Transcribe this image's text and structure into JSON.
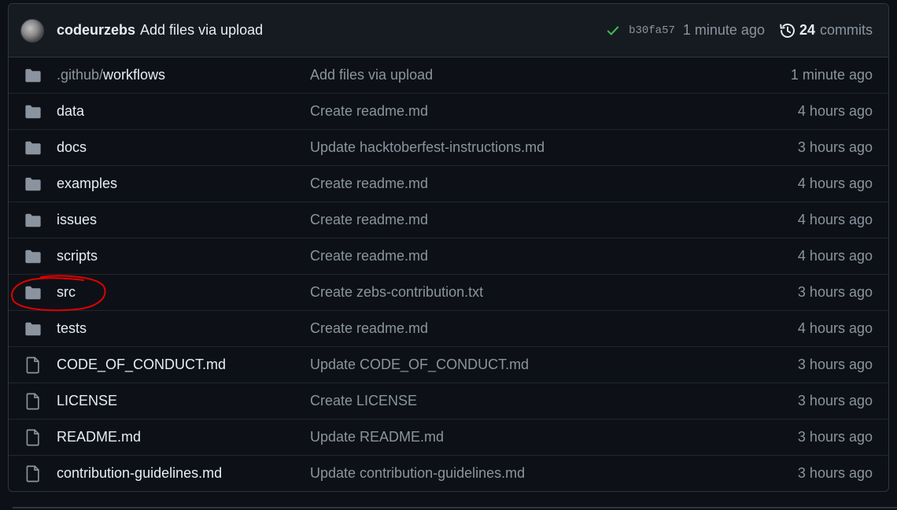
{
  "commit": {
    "author": "codeurzebs",
    "message": "Add files via upload",
    "sha": "b30fa57",
    "time": "1 minute ago",
    "count": "24",
    "count_label": "commits"
  },
  "files": [
    {
      "type": "folder",
      "prefix": ".github/",
      "name": "workflows",
      "message": "Add files via upload",
      "age": "1 minute ago"
    },
    {
      "type": "folder",
      "prefix": "",
      "name": "data",
      "message": "Create readme.md",
      "age": "4 hours ago"
    },
    {
      "type": "folder",
      "prefix": "",
      "name": "docs",
      "message": "Update hacktoberfest-instructions.md",
      "age": "3 hours ago"
    },
    {
      "type": "folder",
      "prefix": "",
      "name": "examples",
      "message": "Create readme.md",
      "age": "4 hours ago"
    },
    {
      "type": "folder",
      "prefix": "",
      "name": "issues",
      "message": "Create readme.md",
      "age": "4 hours ago"
    },
    {
      "type": "folder",
      "prefix": "",
      "name": "scripts",
      "message": "Create readme.md",
      "age": "4 hours ago"
    },
    {
      "type": "folder",
      "prefix": "",
      "name": "src",
      "message": "Create zebs-contribution.txt",
      "age": "3 hours ago"
    },
    {
      "type": "folder",
      "prefix": "",
      "name": "tests",
      "message": "Create readme.md",
      "age": "4 hours ago"
    },
    {
      "type": "file",
      "prefix": "",
      "name": "CODE_OF_CONDUCT.md",
      "message": "Update CODE_OF_CONDUCT.md",
      "age": "3 hours ago"
    },
    {
      "type": "file",
      "prefix": "",
      "name": "LICENSE",
      "message": "Create LICENSE",
      "age": "3 hours ago"
    },
    {
      "type": "file",
      "prefix": "",
      "name": "README.md",
      "message": "Update README.md",
      "age": "3 hours ago"
    },
    {
      "type": "file",
      "prefix": "",
      "name": "contribution-guidelines.md",
      "message": "Update contribution-guidelines.md",
      "age": "3 hours ago"
    }
  ],
  "colors": {
    "background": "#0d1117",
    "header": "#161b22",
    "border": "#30363d",
    "text": "#e6edf3",
    "muted": "#8b949e",
    "success": "#3fb950",
    "annotation": "#e00000"
  },
  "icons": {
    "folder": "folder-icon",
    "file": "file-icon",
    "check": "check-icon",
    "history": "history-icon"
  }
}
